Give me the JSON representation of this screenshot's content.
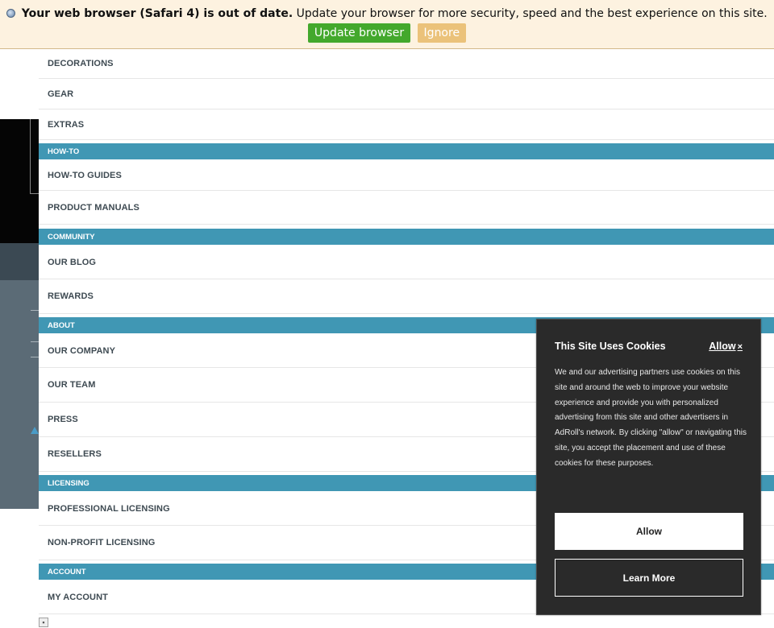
{
  "banner": {
    "icon": "safari-globe-icon",
    "headline": "Your web browser (Safari 4) is out of date.",
    "message": "Update your browser for more security, speed and the best experience on this site.",
    "update_label": "Update browser",
    "ignore_label": "Ignore",
    "update_color": "#43a82c",
    "ignore_color": "#ebc27a"
  },
  "menu": {
    "header_color": "#4097b4",
    "items": [
      "DECORATIONS",
      "GEAR",
      "EXTRAS",
      "HOW-TO",
      "HOW-TO GUIDES",
      "PRODUCT MANUALS",
      "COMMUNITY",
      "OUR BLOG",
      "REWARDS",
      "ABOUT",
      "OUR COMPANY",
      "OUR TEAM",
      "PRESS",
      "RESELLERS",
      "LICENSING",
      "PROFESSIONAL LICENSING",
      "NON-PROFIT LICENSING",
      "ACCOUNT",
      "MY ACCOUNT"
    ]
  },
  "cookie": {
    "title": "This Site Uses Cookies",
    "allow_link": "Allow",
    "close_glyph": "×",
    "body": "We and our advertising partners use cookies on this site and around the web to improve your website experience and provide you with personalized advertising from this site and other advertisers in AdRoll's network. By clicking \"allow\" or navigating this site, you accept the placement and use of these cookies for these purposes.",
    "allow_button": "Allow",
    "learn_more_button": "Learn More"
  }
}
